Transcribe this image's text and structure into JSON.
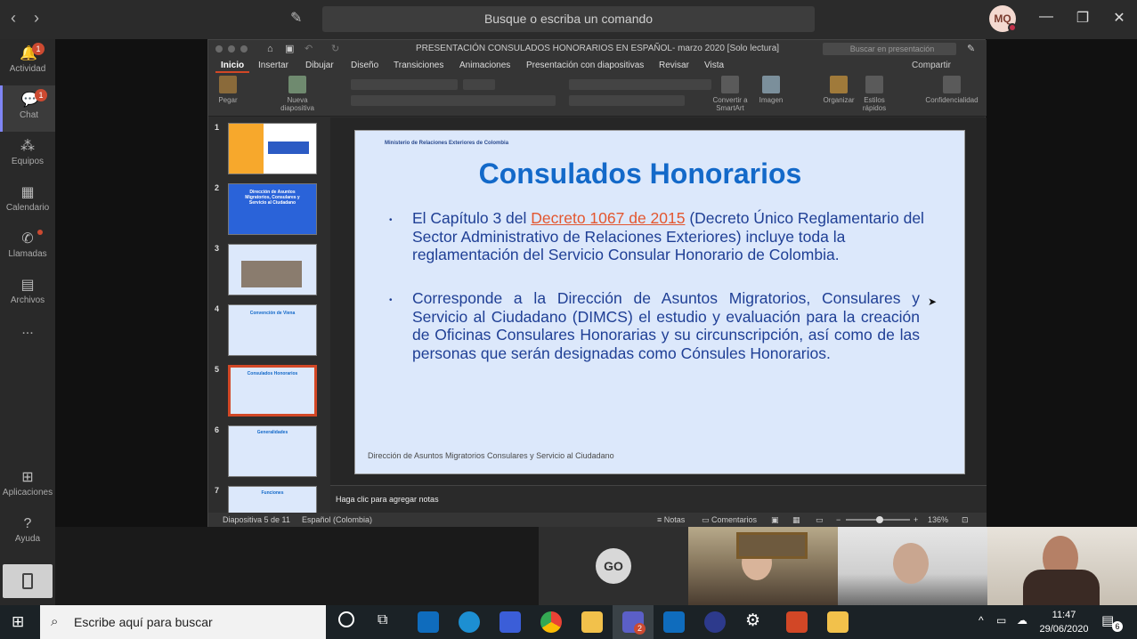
{
  "teams": {
    "search_placeholder": "Busque o escriba un comando",
    "avatar_initials": "MQ",
    "rail": [
      {
        "label": "Actividad",
        "badge": "1"
      },
      {
        "label": "Chat",
        "badge": "1"
      },
      {
        "label": "Equipos",
        "badge": ""
      },
      {
        "label": "Calendario",
        "badge": ""
      },
      {
        "label": "Llamadas",
        "badge": ""
      },
      {
        "label": "Archivos",
        "badge": ""
      },
      {
        "label": "...",
        "badge": ""
      },
      {
        "label": "Aplicaciones",
        "badge": ""
      },
      {
        "label": "Ayuda",
        "badge": ""
      }
    ]
  },
  "ppt": {
    "title": "PRESENTACIÓN CONSULADOS HONORARIOS EN  ESPAÑOL- marzo 2020 [Solo lectura]",
    "search_placeholder": "Buscar en presentación",
    "share": "Compartir",
    "tabs": [
      "Inicio",
      "Insertar",
      "Dibujar",
      "Diseño",
      "Transiciones",
      "Animaciones",
      "Presentación con diapositivas",
      "Revisar",
      "Vista"
    ],
    "ribbon": {
      "paste": "Pegar",
      "new_slide": "Nueva diapositiva",
      "smartart": "Convertir a SmartArt",
      "image": "Imagen",
      "arrange": "Organizar",
      "quick_styles": "Estilos rápidos",
      "confidentiality": "Confidencialidad"
    },
    "thumbs": [
      "1",
      "2",
      "3",
      "4",
      "5",
      "6",
      "7"
    ],
    "thumb_titles": {
      "t2": "Dirección de Asuntos Migratorios, Consulares y Servicio al Ciudadano",
      "t4": "Convención de Viena",
      "t5": "Consulados Honorarios",
      "t6": "Generalidades",
      "t7": "Funciones"
    },
    "slide": {
      "ministry": "Ministerio de Relaciones Exteriores de Colombia",
      "title": "Consulados Honorarios",
      "b1_pre": "El Capítulo 3 del ",
      "b1_link": "Decreto 1067 de 2015",
      "b1_post": " (Decreto Único Reglamentario del Sector Administrativo de Relaciones Exteriores) incluye toda la reglamentación del Servicio Consular Honorario de Colombia.",
      "b2": "Corresponde a la Dirección de Asuntos Migratorios, Consulares y Servicio al Ciudadano (DIMCS) el estudio y evaluación para la creación de Oficinas Consulares Honorarias y su circunscripción, así como de las personas que serán designadas como Cónsules Honorarios.",
      "footer": "Dirección de Asuntos Migratorios Consulares y Servicio al Ciudadano"
    },
    "notes_placeholder": "Haga clic para agregar notas",
    "status": {
      "slide": "Diapositiva 5 de 11",
      "lang": "Español (Colombia)",
      "notes": "Notas",
      "comments": "Comentarios",
      "zoom": "136%"
    }
  },
  "participants": {
    "go_initials": "GO"
  },
  "taskbar": {
    "search_placeholder": "Escribe aquí para buscar",
    "time": "11:47",
    "date": "29/06/2020",
    "notif": "6",
    "teams_badge": "2"
  },
  "colors": {
    "accent": "#d24726",
    "slide_title": "#1369c9",
    "slide_text": "#1f3f95",
    "link": "#e3562f"
  }
}
